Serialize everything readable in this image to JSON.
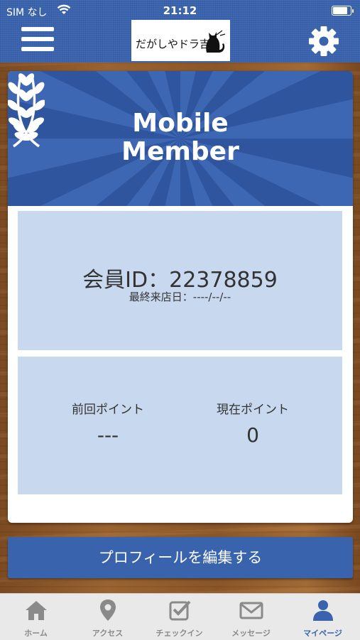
{
  "status_bar": {
    "carrier": "SIM なし",
    "time": "21:12"
  },
  "header": {
    "logo_text": "だがしやドラ吉"
  },
  "card": {
    "banner_line1": "Mobile",
    "banner_line2": "Member",
    "member_id": "会員ID：22378859",
    "last_visit": "最終来店日：----/--/--",
    "previous_points_label": "前回ポイント",
    "previous_points_value": "---",
    "current_points_label": "現在ポイント",
    "current_points_value": "0"
  },
  "edit_profile_label": "プロフィールを編集する",
  "tabs": [
    {
      "label": "ホーム",
      "icon": "home-icon"
    },
    {
      "label": "アクセス",
      "icon": "map-pin-icon"
    },
    {
      "label": "チェックイン",
      "icon": "checkbox-icon"
    },
    {
      "label": "メッセージ",
      "icon": "envelope-icon"
    },
    {
      "label": "マイページ",
      "icon": "person-icon"
    }
  ],
  "colors": {
    "brand_blue": "#3a63ad",
    "panel_blue": "#c7d8ef",
    "tab_active": "#3a63ad",
    "tab_inactive": "#8a8a8a"
  }
}
